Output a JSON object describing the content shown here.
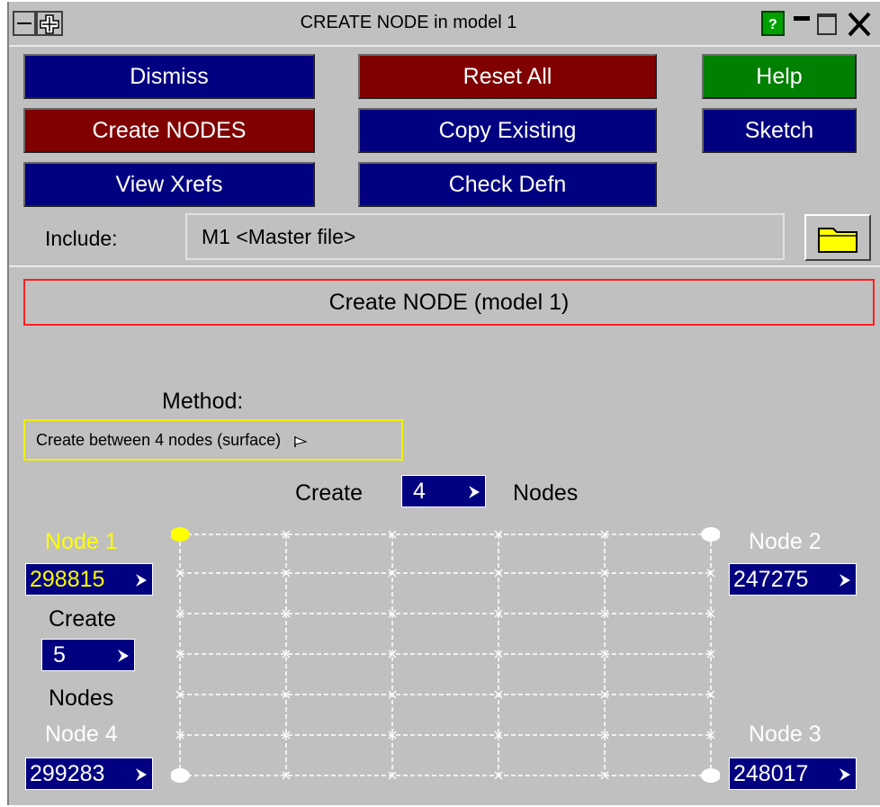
{
  "window": {
    "title": "CREATE NODE in model 1"
  },
  "buttons": {
    "dismiss": "Dismiss",
    "reset_all": "Reset All",
    "help": "Help",
    "create_nodes": "Create NODES",
    "copy_existing": "Copy Existing",
    "sketch": "Sketch",
    "view_xrefs": "View Xrefs",
    "check_defn": "Check Defn"
  },
  "include": {
    "label": "Include:",
    "value": "M1  <Master file>"
  },
  "panel": {
    "title": "Create NODE (model 1)"
  },
  "method": {
    "label": "Method:",
    "selected": "Create between 4 nodes (surface)"
  },
  "create_row": {
    "prefix": "Create",
    "count": "4",
    "suffix": "Nodes"
  },
  "nodes": {
    "node1": {
      "label": "Node 1",
      "value": "298815"
    },
    "node2": {
      "label": "Node 2",
      "value": "247275"
    },
    "node3": {
      "label": "Node 3",
      "value": "248017"
    },
    "node4": {
      "label": "Node 4",
      "value": "299283"
    }
  },
  "create_col": {
    "prefix": "Create",
    "count": "5",
    "suffix": "Nodes"
  },
  "colors": {
    "navy": "#000080",
    "maroon": "#800000",
    "green": "#008000",
    "panel_gray": "#c0c0c0",
    "highlight_yellow": "#ffff00",
    "title_border_red": "#ff2020"
  },
  "icons": [
    "minus-icon",
    "move-cross-icon",
    "help-question-icon",
    "minimize-icon",
    "maximize-icon",
    "close-icon",
    "folder-icon",
    "dropdown-flag-icon"
  ]
}
